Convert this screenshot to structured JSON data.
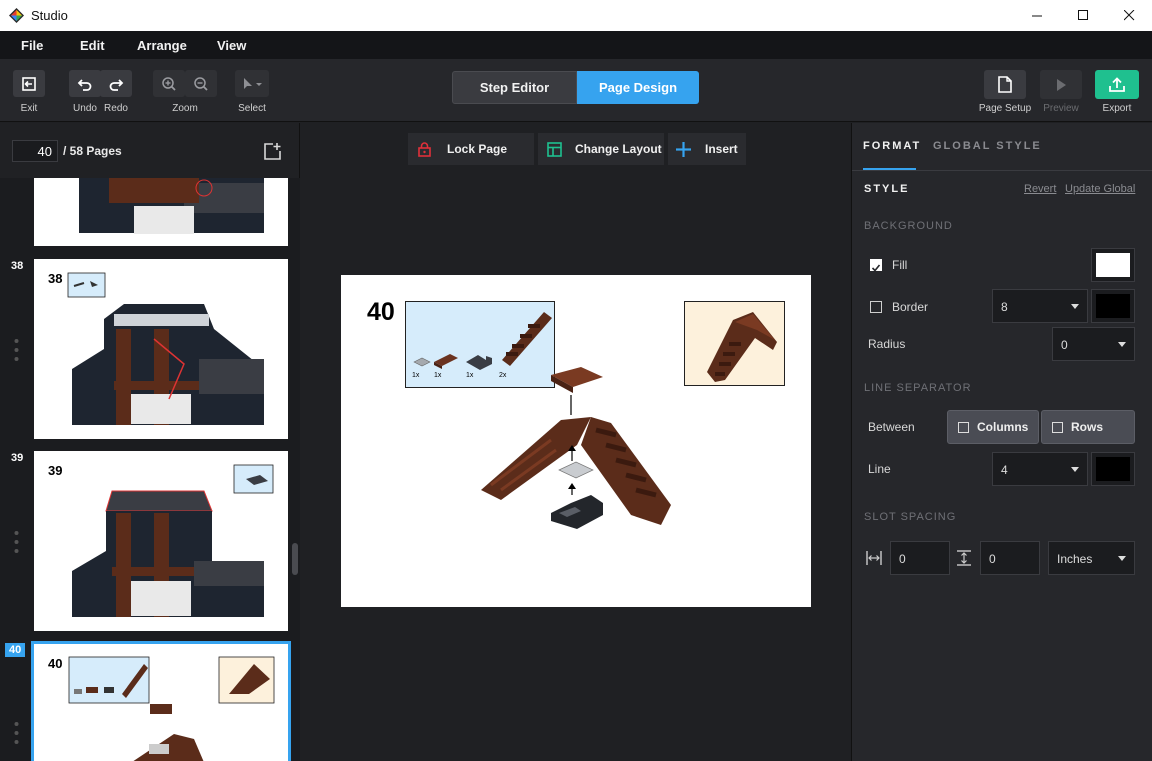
{
  "window": {
    "title": "Studio"
  },
  "menu": {
    "file": "File",
    "edit": "Edit",
    "arrange": "Arrange",
    "view": "View"
  },
  "toolbar": {
    "exit": "Exit",
    "undo": "Undo",
    "redo": "Redo",
    "zoom": "Zoom",
    "select": "Select",
    "step_editor": "Step Editor",
    "page_design": "Page Design",
    "page_setup": "Page Setup",
    "preview": "Preview",
    "export": "Export"
  },
  "pages": {
    "current": "40",
    "of_label": "/ 58 Pages",
    "thumbnails": [
      {
        "num": "38",
        "step": "38"
      },
      {
        "num": "39",
        "step": "39"
      },
      {
        "num": "40",
        "step": "40"
      }
    ]
  },
  "canvas_tools": {
    "lock": "Lock Page",
    "layout": "Change Layout",
    "insert": "Insert"
  },
  "page": {
    "step_number": "40",
    "parts": [
      {
        "qty": "1x"
      },
      {
        "qty": "1x"
      },
      {
        "qty": "1x"
      },
      {
        "qty": "2x"
      }
    ]
  },
  "format": {
    "tab_format": "FORMAT",
    "tab_global": "GLOBAL STYLE",
    "style_title": "STYLE",
    "revert": "Revert",
    "update_global": "Update Global",
    "background_title": "BACKGROUND",
    "fill_label": "Fill",
    "fill_color": "#ffffff",
    "border_label": "Border",
    "border_value": "8",
    "border_color": "#000000",
    "radius_label": "Radius",
    "radius_value": "0",
    "separator_title": "LINE SEPARATOR",
    "between_label": "Between",
    "columns": "Columns",
    "rows": "Rows",
    "line_label": "Line",
    "line_value": "4",
    "line_color": "#000000",
    "spacing_title": "SLOT SPACING",
    "spacing_h": "0",
    "spacing_v": "0",
    "unit": "Inches"
  },
  "colors": {
    "accent": "#36a3ef",
    "export": "#1fc08f",
    "brick_brown": "#5b2c1a",
    "callout_bg": "#d6ecfb",
    "preview_bg": "#fdf1dc"
  }
}
